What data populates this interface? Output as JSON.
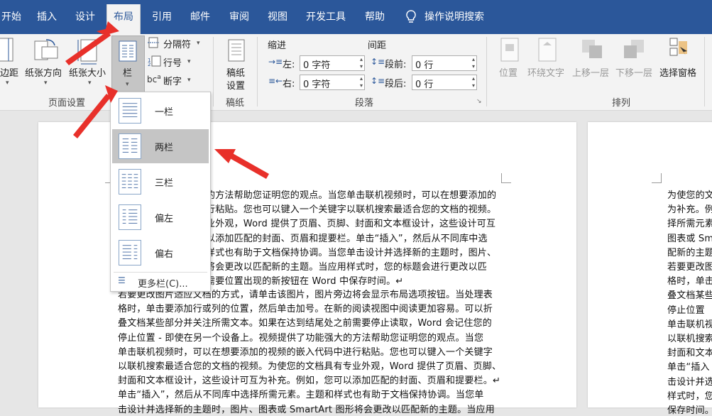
{
  "tabs": [
    "开始",
    "插入",
    "设计",
    "布局",
    "引用",
    "邮件",
    "审阅",
    "视图",
    "开发工具",
    "帮助"
  ],
  "tell_me": "操作说明搜索",
  "ribbon": {
    "margins": "边距",
    "orientation": "纸张方向",
    "size": "纸张大小",
    "columns": "栏",
    "breaks": "分隔符",
    "line_numbers": "行号",
    "hyphenation": "断字",
    "draft_line1": "稿纸",
    "draft_line2": "设置",
    "indent": "缩进",
    "spacing": "间距",
    "left_label": "左:",
    "right_label": "右:",
    "before_label": "段前:",
    "after_label": "段后:",
    "left_value": "0 字符",
    "right_value": "0 字符",
    "before_value": "0 行",
    "after_value": "0 行",
    "position": "位置",
    "wrap": "环绕文字",
    "forward": "上移一层",
    "backward": "下移一层",
    "selection_pane": "选择窗格",
    "group_page_setup": "页面设置",
    "group_draft": "稿纸",
    "group_paragraph": "段落",
    "group_arrange": "排列"
  },
  "columns_menu": {
    "items": [
      "一栏",
      "两栏",
      "三栏",
      "偏左",
      "偏右"
    ],
    "selected": "两栏",
    "more": "更多栏(C)..."
  },
  "doc_lines_right": [
    "的方法帮助您证明您的观点。当您单击联机视频时，可以在想要添加的",
    "行粘贴。您也可以键入一个关键字以联机搜索最适合您的文档的视频。",
    "业外观，Word 提供了页眉、页脚、封面和文本框设计，这些设计可互",
    "以添加匹配的封面、页眉和提要栏。单击“插入”，然后从不同库中选",
    "样式也有助于文档保持协调。当您单击设计并选择新的主题时，图片、",
    "将会更改以匹配新的主题。当应用样式时，您的标题会进行更改以匹",
    "需要位置出现的新按钮在 Word 中保存时间。↵"
  ],
  "doc_lines_full": [
    "若要更改图片适应文档的方式，请单击该图片，图片旁边将会显示布局选项按钮。当处理表",
    "格时，单击要添加行或列的位置，然后单击加号。在新的阅读视图中阅读更加容易。可以折",
    "叠文档某些部分并关注所需文本。如果在达到结尾处之前需要停止读取，Word 会记住您的",
    "停止位置 - 即使在另一个设备上。视频提供了功能强大的方法帮助您证明您的观点。当您",
    "单击联机视频时，可以在想要添加的视频的嵌入代码中进行粘贴。您也可以键入一个关键字",
    "以联机搜索最适合您的文档的视频。为使您的文档具有专业外观，Word 提供了页眉、页脚、",
    "封面和文本框设计，这些设计可互为补充。例如，您可以添加匹配的封面、页眉和提要栏。↵",
    "单击“插入”，然后从不同库中选择所需元素。主题和样式也有助于文档保持协调。当您单",
    "击设计并选择新的主题时，图片、图表或 SmartArt 图形将会更改以匹配新的主题。当应用"
  ],
  "doc2_lines": [
    "为使您的文",
    "为补充。例",
    "择所需元素",
    "图表或 Sm",
    "配新的主题",
    "若要更改图",
    "格时，单击",
    "叠文档某些",
    "停止位置",
    "单击联机视",
    "以联机搜索",
    "封面和文本",
    "单击“插入",
    "击设计并选",
    "样式时，您",
    "保存时间。"
  ],
  "colors": {
    "accent": "#2b579a",
    "arrow": "#e8302a"
  }
}
